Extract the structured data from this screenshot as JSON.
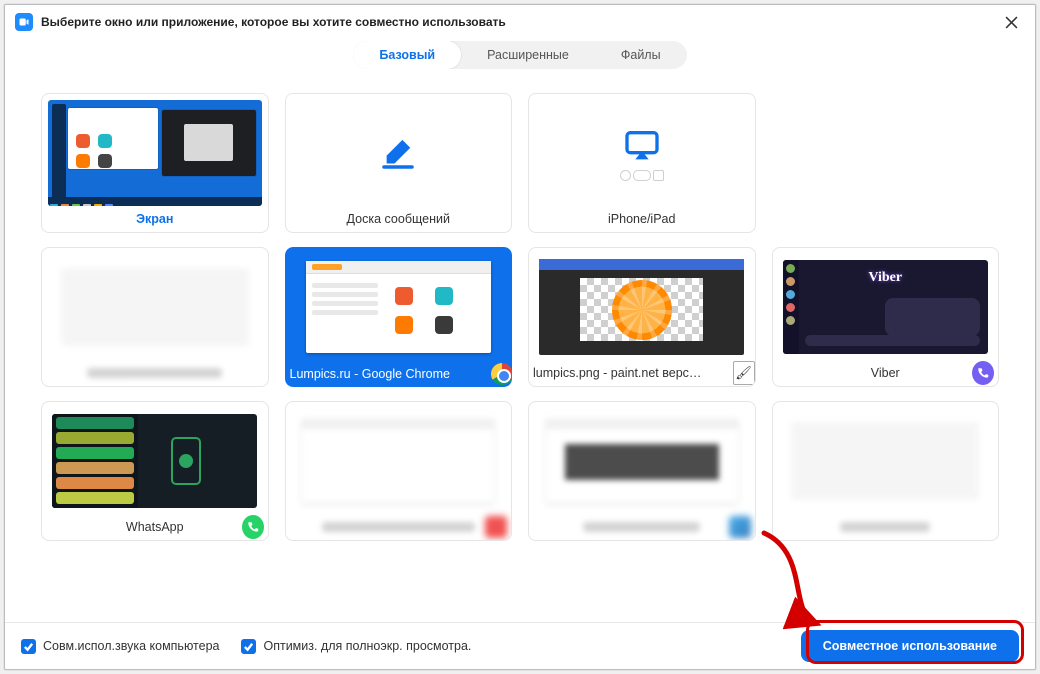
{
  "title": "Выберите окно или приложение, которое вы хотите совместно использовать",
  "tabs": {
    "basic": "Базовый",
    "advanced": "Расширенные",
    "files": "Файлы"
  },
  "options": {
    "screen": "Экран",
    "whiteboard": "Доска сообщений",
    "iphone": "iPhone/iPad",
    "blank1": "",
    "chrome": "Lumpics.ru - Google Chrome",
    "paint": "lumpics.png - paint.net версия 4...",
    "viber": "Viber",
    "whatsapp": "WhatsApp",
    "blur2": "",
    "blur3": "",
    "blur4": ""
  },
  "footer": {
    "chk_audio": "Совм.испол.звука компьютера",
    "chk_optimize": "Оптимиз. для полноэкр. просмотра.",
    "share": "Совместное использование"
  }
}
